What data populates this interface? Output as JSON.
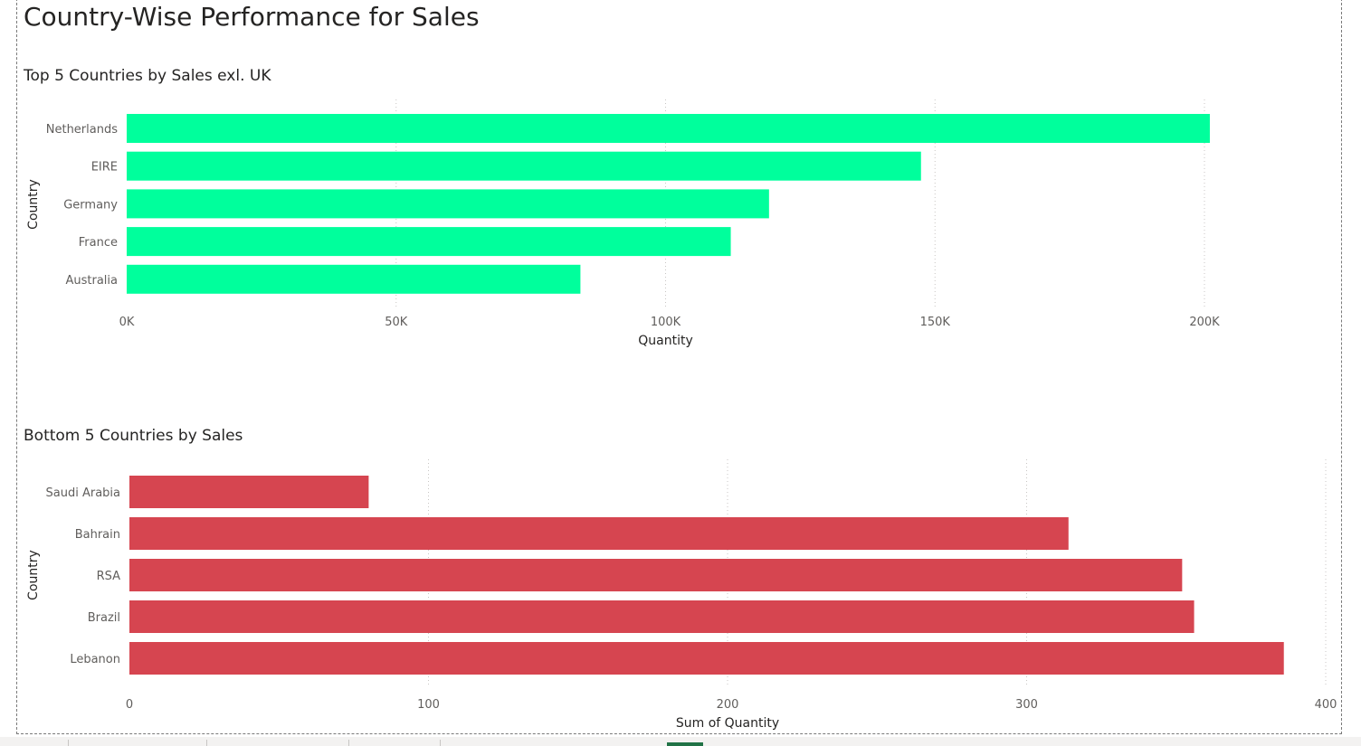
{
  "page": {
    "title": "Country-Wise Performance for Sales"
  },
  "chart_data": [
    {
      "type": "bar",
      "orientation": "horizontal",
      "title": "Top 5 Countries by Sales exl. UK",
      "xlabel": "Quantity",
      "ylabel": "Country",
      "categories": [
        "Netherlands",
        "EIRE",
        "Germany",
        "France",
        "Australia"
      ],
      "values": [
        201000,
        147400,
        119200,
        112100,
        84200
      ],
      "xlim": [
        0,
        200000
      ],
      "ticks": [
        0,
        50000,
        100000,
        150000,
        200000
      ],
      "tick_labels": [
        "0K",
        "50K",
        "100K",
        "150K",
        "200K"
      ],
      "grid": true,
      "color": "#00FF9C"
    },
    {
      "type": "bar",
      "orientation": "horizontal",
      "title": "Bottom 5 Countries by Sales",
      "xlabel": "Sum of Quantity",
      "ylabel": "Country",
      "categories": [
        "Saudi Arabia",
        "Bahrain",
        "RSA",
        "Brazil",
        "Lebanon"
      ],
      "values": [
        80,
        314,
        352,
        356,
        386
      ],
      "xlim": [
        0,
        400
      ],
      "ticks": [
        0,
        100,
        200,
        300,
        400
      ],
      "tick_labels": [
        "0",
        "100",
        "200",
        "300",
        "400"
      ],
      "grid": true,
      "color": "#D64550"
    }
  ]
}
